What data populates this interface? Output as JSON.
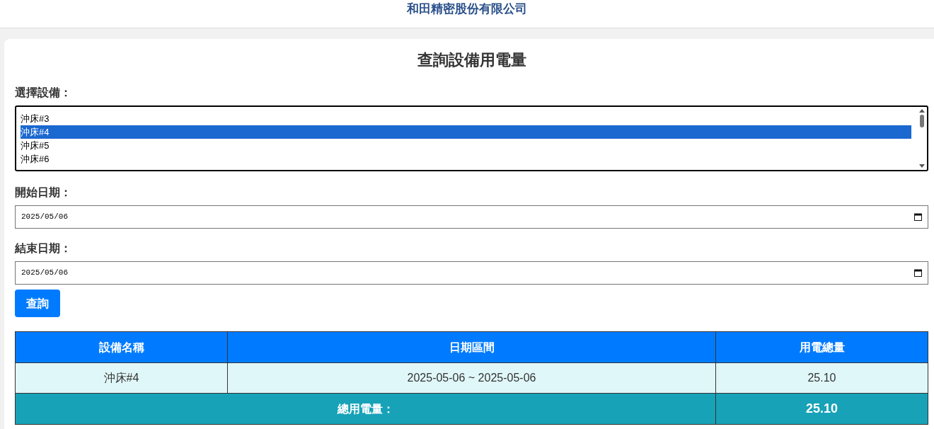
{
  "header": {
    "company": "和田精密股份有限公司"
  },
  "title": "查詢設備用電量",
  "equipment": {
    "label": "選擇設備：",
    "options": [
      {
        "label": "沖床#3",
        "selected": false
      },
      {
        "label": "沖床#4",
        "selected": true
      },
      {
        "label": "沖床#5",
        "selected": false
      },
      {
        "label": "沖床#6",
        "selected": false
      }
    ]
  },
  "start_date": {
    "label": "開始日期：",
    "value": "2025/05/06"
  },
  "end_date": {
    "label": "結束日期：",
    "value": "2025/05/06"
  },
  "query_button": "查詢",
  "table": {
    "columns": [
      "設備名稱",
      "日期區間",
      "用電總量"
    ],
    "rows": [
      [
        "沖床#4",
        "2025-05-06 ~ 2025-05-06",
        "25.10"
      ]
    ],
    "total": {
      "label": "總用電量：",
      "value": "25.10"
    }
  }
}
